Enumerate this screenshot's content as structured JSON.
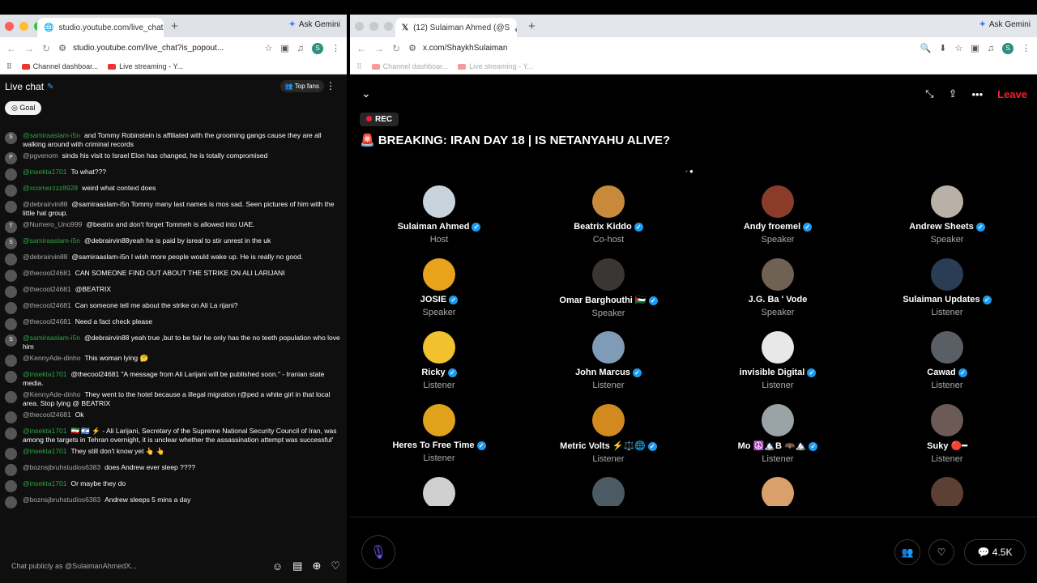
{
  "left": {
    "tab": {
      "title": "studio.youtube.com/live_chat",
      "close": "×"
    },
    "new_tab": "+",
    "gemini": "Ask Gemini",
    "url": "studio.youtube.com/live_chat?is_popout...",
    "bookmarks": [
      "Channel dashboar...",
      "Live streaming - Y..."
    ],
    "chat": {
      "title": "Live chat",
      "top_fans": "Top fans",
      "goal": "Goal",
      "messages": [
        {
          "name": "@samiraaslam-i5n",
          "text": "and Tommy Robinstein is affiliated with the grooming gangs cause they are all walking around with criminal records",
          "green": true,
          "av": "S"
        },
        {
          "name": "@pgvenom",
          "text": "sinds his visit to Israel Elon has changed, he is totally compromised",
          "green": false,
          "av": "P"
        },
        {
          "name": "@insekta1701",
          "text": "To what???",
          "green": true,
          "av": ""
        },
        {
          "name": "@xcomerzzz8928",
          "text": "weird what context does",
          "green": true,
          "av": ""
        },
        {
          "name": "@debrairvin88",
          "text": "@samiraaslam-i5n Tommy many last names is mos sad. Seen pictures of him with the little hat group.",
          "green": false,
          "av": ""
        },
        {
          "name": "@Numero_Uno999",
          "text": "@beatrix and don't forget Tommeh is allowed into UAE.",
          "green": false,
          "av": "T"
        },
        {
          "name": "@samiraaslam-i5n",
          "text": "@debrairvin88yeah he is paid by isreal to stir unrest in the uk",
          "green": true,
          "av": "S"
        },
        {
          "name": "@debrairvin88",
          "text": "@samiraaslam-i5n I wish more people would wake up. He is really no good.",
          "green": false,
          "av": ""
        },
        {
          "name": "@thecool24681",
          "text": "CAN SOMEONE FIND OUT ABOUT THE STRIKE ON ALI LARIJANI",
          "green": false,
          "av": ""
        },
        {
          "name": "@thecool24681",
          "text": "@BEATRIX",
          "green": false,
          "av": ""
        },
        {
          "name": "@thecool24681",
          "text": "Can someone tell me about the strike on Ali La rijani?",
          "green": false,
          "av": ""
        },
        {
          "name": "@thecool24681",
          "text": "Need a fact check please",
          "green": false,
          "av": ""
        },
        {
          "name": "@samiraaslam-i5n",
          "text": "@debrairvin88 yeah true ,but to be fair he only has the no teeth population who love him",
          "green": true,
          "av": "S"
        },
        {
          "name": "@KennyAde-dinho",
          "text": "This woman lying 🤔",
          "green": false,
          "av": ""
        },
        {
          "name": "@insekta1701",
          "text": "@thecool24681 \"A message from Ali Larijani will be published soon.\" - Iranian state media.",
          "green": true,
          "av": ""
        },
        {
          "name": "@KennyAde-dinho",
          "text": "They went to the hotel because a illegal migration r@ped a white girl in that local area. Stop lying @ BEATRIX",
          "green": false,
          "av": ""
        },
        {
          "name": "@thecool24681",
          "text": "Ok",
          "green": false,
          "av": ""
        },
        {
          "name": "@insekta1701",
          "text": "🇮🇷 🇮🇱 ⚡ - Ali Larijani, Secretary of the Supreme National Security Council of Iran, was among the targets in Tehran overnight, it is unclear whether the assassination attempt was successful'",
          "green": true,
          "av": ""
        },
        {
          "name": "@insekta1701",
          "text": "They still don't know yet 👆 👆",
          "green": true,
          "av": ""
        },
        {
          "name": "@boznsjbruhstudios6383",
          "text": "does Andrew ever sleep ????",
          "green": false,
          "av": ""
        },
        {
          "name": "@insekta1701",
          "text": "Or maybe they do",
          "green": true,
          "av": ""
        },
        {
          "name": "@boznsjbruhstudios6383",
          "text": "Andrew sleeps 5 mins a day",
          "green": false,
          "av": ""
        }
      ],
      "input_placeholder": "Chat publicly as @SulaimanAhmedX..."
    }
  },
  "right": {
    "tab": {
      "title": "(12) Sulaiman Ahmed (@S",
      "close": "×"
    },
    "new_tab": "+",
    "gemini": "Ask Gemini",
    "url": "x.com/ShaykhSulaiman",
    "bookmarks": [
      "Channel dashboar...",
      "Live streaming - Y..."
    ],
    "space": {
      "leave": "Leave",
      "rec": "REC",
      "title": "🚨 BREAKING: IRAN DAY 18 | IS NETANYAHU ALIVE?",
      "participants": [
        {
          "name": "Sulaiman Ahmed",
          "role": "Host",
          "verified": true,
          "color": "#c9d3dc"
        },
        {
          "name": "Beatrix Kiddo",
          "role": "Co-host",
          "verified": true,
          "color": "#c88a3a"
        },
        {
          "name": "Andy froemel",
          "role": "Speaker",
          "verified": true,
          "color": "#8a3b2a"
        },
        {
          "name": "Andrew Sheets",
          "role": "Speaker",
          "verified": true,
          "color": "#b9b1a8"
        },
        {
          "name": "JOSIE",
          "role": "Speaker",
          "verified": true,
          "color": "#e8a21c"
        },
        {
          "name": "Omar Barghouthi 🇵🇸",
          "role": "Speaker",
          "verified": true,
          "color": "#3a3633"
        },
        {
          "name": "J.G. Ba ' Vode",
          "role": "Speaker",
          "verified": false,
          "color": "#6f6154"
        },
        {
          "name": "Sulaiman Updates",
          "role": "Listener",
          "verified": true,
          "color": "#2b3c55"
        },
        {
          "name": "Ricky",
          "role": "Listener",
          "verified": true,
          "color": "#f2c12e"
        },
        {
          "name": "John Marcus",
          "role": "Listener",
          "verified": true,
          "color": "#7f9bb5"
        },
        {
          "name": "invisible Digital",
          "role": "Listener",
          "verified": true,
          "color": "#e8e8e8"
        },
        {
          "name": "Cawad",
          "role": "Listener",
          "verified": true,
          "color": "#5a5f66"
        },
        {
          "name": "Heres To Free Time",
          "role": "Listener",
          "verified": true,
          "color": "#e0a21a"
        },
        {
          "name": "Metric Volts ⚡⚖️🌐",
          "role": "Listener",
          "verified": true,
          "color": "#d28a1e"
        },
        {
          "name": "Mo ☮️🏔️B 🦇🏔️",
          "role": "Listener",
          "verified": true,
          "color": "#9aa3a5"
        },
        {
          "name": "Suky 🔴━",
          "role": "Listener",
          "verified": false,
          "color": "#6b5a55"
        },
        {
          "name": "",
          "role": "",
          "verified": false,
          "color": "#cfcfcf"
        },
        {
          "name": "",
          "role": "",
          "verified": false,
          "color": "#4b5a63"
        },
        {
          "name": "",
          "role": "",
          "verified": false,
          "color": "#d9a06b"
        },
        {
          "name": "",
          "role": "",
          "verified": false,
          "color": "#5d4034"
        }
      ],
      "comment_count": "4.5K"
    }
  }
}
